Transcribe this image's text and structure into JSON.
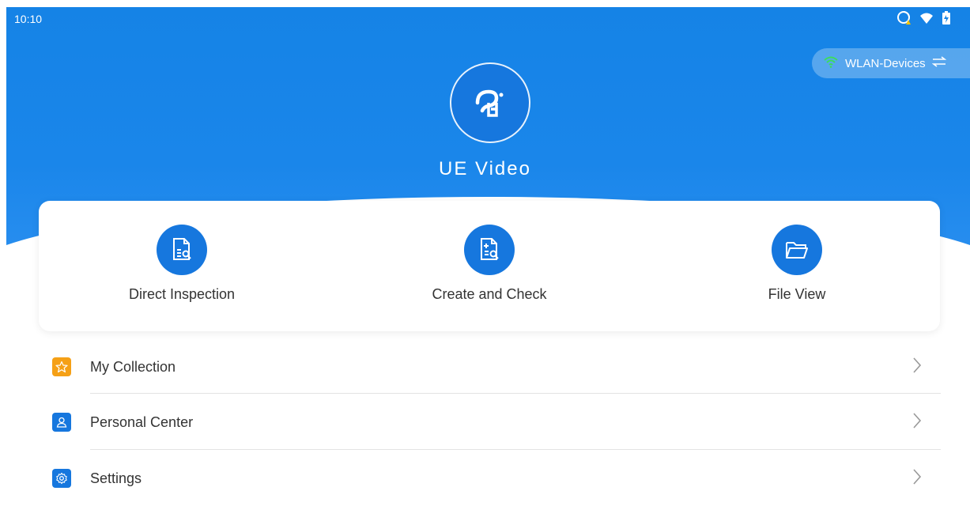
{
  "status_bar": {
    "time": "10:10",
    "icons": [
      "data-saver-warning-icon",
      "wifi-icon",
      "battery-charging-icon"
    ]
  },
  "wlan": {
    "label": "WLAN-Devices",
    "icon": "wifi-icon",
    "switch_icon": "swap-icon"
  },
  "app": {
    "title": "UE Video",
    "logo": "ue-logo"
  },
  "actions": [
    {
      "label": "Direct Inspection",
      "icon": "document-search-icon"
    },
    {
      "label": "Create and Check",
      "icon": "document-plus-search-icon"
    },
    {
      "label": "File View",
      "icon": "folder-icon"
    }
  ],
  "menu": [
    {
      "label": "My Collection",
      "icon": "star-icon",
      "color": "#f5a016"
    },
    {
      "label": "Personal Center",
      "icon": "user-icon",
      "color": "#1677de"
    },
    {
      "label": "Settings",
      "icon": "gear-icon",
      "color": "#1677de"
    }
  ],
  "colors": {
    "primary": "#1677de",
    "header": "#1583e6",
    "collection": "#f5a016",
    "wifi": "#3ddc5e"
  }
}
